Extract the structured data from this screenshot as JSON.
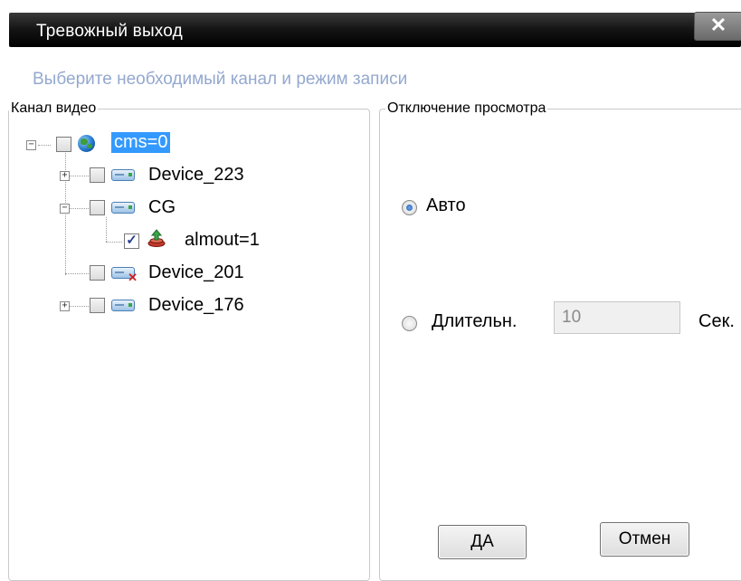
{
  "window": {
    "title": "Тревожный выход",
    "close_glyph": "✕"
  },
  "hint": "Выберите необходимый канал и режим записи",
  "left_group": {
    "legend": "Канал видео",
    "tree": [
      {
        "label": "cms=0",
        "icon": "globe-icon",
        "expanded": true,
        "checked": false,
        "selected": true
      },
      {
        "label": "Device_223",
        "icon": "device-icon",
        "expanded": false,
        "checked": false
      },
      {
        "label": "CG",
        "icon": "device-icon",
        "expanded": true,
        "checked": false
      },
      {
        "label": "almout=1",
        "icon": "alarm-output-icon",
        "checked": true
      },
      {
        "label": "Device_201",
        "icon": "device-offline-icon",
        "checked": false
      },
      {
        "label": "Device_176",
        "icon": "device-icon",
        "expanded": false,
        "checked": false
      }
    ]
  },
  "right_group": {
    "legend": "Отключение просмотра",
    "auto_label": "Авто",
    "duration_label": "Длительн.",
    "duration_value": "10",
    "seconds_label": "Сек.",
    "selected_mode": "auto"
  },
  "buttons": {
    "ok": "ДА",
    "cancel": "Отмен"
  },
  "colors": {
    "hint": "#94a8cf",
    "selection": "#3399ff",
    "titlebar": "#161616"
  }
}
